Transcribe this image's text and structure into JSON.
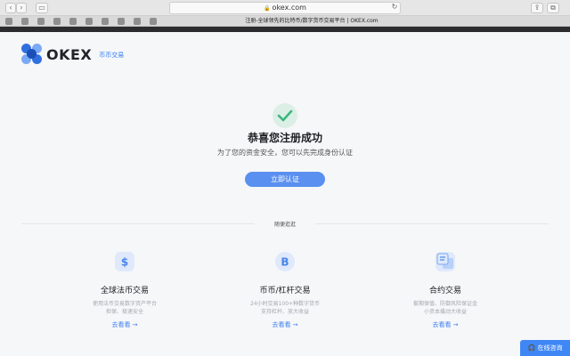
{
  "browser": {
    "url": "okex.com",
    "tab_title": "注册-全球领先的比特币/数字货币交易平台 | OKEX.com",
    "icons": {
      "back": "chevron-left-icon",
      "forward": "chevron-right-icon",
      "lock": "lock-icon",
      "reload": "reload-icon",
      "share": "share-icon",
      "tabs": "tabs-icon"
    }
  },
  "brand": {
    "name": "OKEX",
    "sub": "币币交易",
    "color": "#2e7bf0"
  },
  "success": {
    "title": "恭喜您注册成功",
    "subtitle": "为了您的资金安全，您可以先完成身份认证",
    "button": "立即认证"
  },
  "section": {
    "label": "随便逛逛"
  },
  "features": [
    {
      "icon": "dollar-icon",
      "title": "全球法币交易",
      "desc1": "使用法币交易数字资产平台",
      "desc2": "担保、极速安全",
      "link": "去看看 →"
    },
    {
      "icon": "bitcoin-icon",
      "title": "币币/杠杆交易",
      "desc1": "24小时交易100+种数字货币",
      "desc2": "支持杠杆、放大收益",
      "link": "去看看 →"
    },
    {
      "icon": "contract-icon",
      "title": "合约交易",
      "desc1": "套期保值、防御风险保证金",
      "desc2": "小资本撬动大收益",
      "link": "去看看 →"
    }
  ],
  "chat": {
    "label": "在线咨询"
  }
}
